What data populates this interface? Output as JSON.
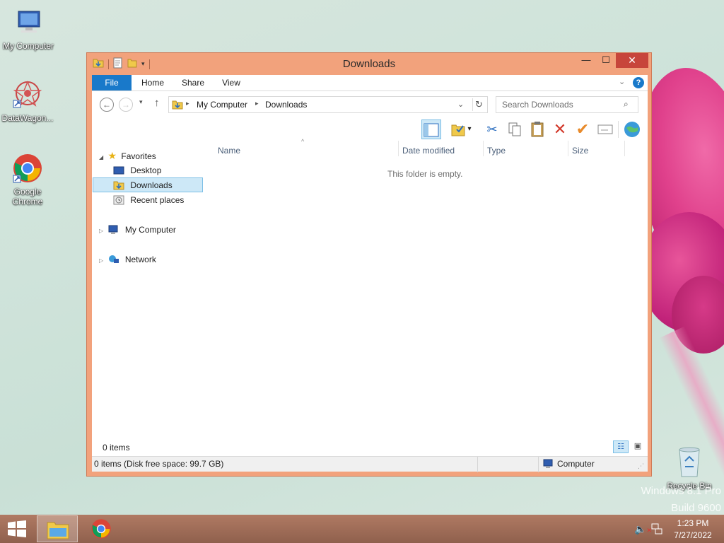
{
  "desktop": {
    "icons": [
      {
        "label": "My Computer"
      },
      {
        "label": "DataWagon..."
      },
      {
        "label": "Google Chrome"
      },
      {
        "label": "Recycle Bin"
      }
    ],
    "watermark": {
      "line1": "Windows 8.1 Pro",
      "line2": "Build 9600"
    }
  },
  "window": {
    "title": "Downloads",
    "controls": {
      "minimize": "—",
      "maximize": "☐",
      "close": "✕"
    },
    "ribbon_tabs": [
      "File",
      "Home",
      "Share",
      "View"
    ],
    "address": {
      "root": "My Computer",
      "current": "Downloads"
    },
    "search": {
      "placeholder": "Search Downloads"
    },
    "nav_pane": {
      "favorites": "Favorites",
      "desktop": "Desktop",
      "downloads": "Downloads",
      "recent_places": "Recent places",
      "my_computer": "My Computer",
      "network": "Network"
    },
    "columns": [
      "Name",
      "Date modified",
      "Type",
      "Size"
    ],
    "empty_message": "This folder is empty.",
    "item_count": "0 items",
    "status": {
      "left": "0 items (Disk free space: 99.7 GB)",
      "right": "Computer"
    }
  },
  "taskbar": {
    "time": "1:23 PM",
    "date": "7/27/2022"
  },
  "colors": {
    "window_frame": "#f2a27c",
    "file_tab": "#1979ca",
    "close_button": "#c7453b",
    "selection": "#cde8f7"
  }
}
